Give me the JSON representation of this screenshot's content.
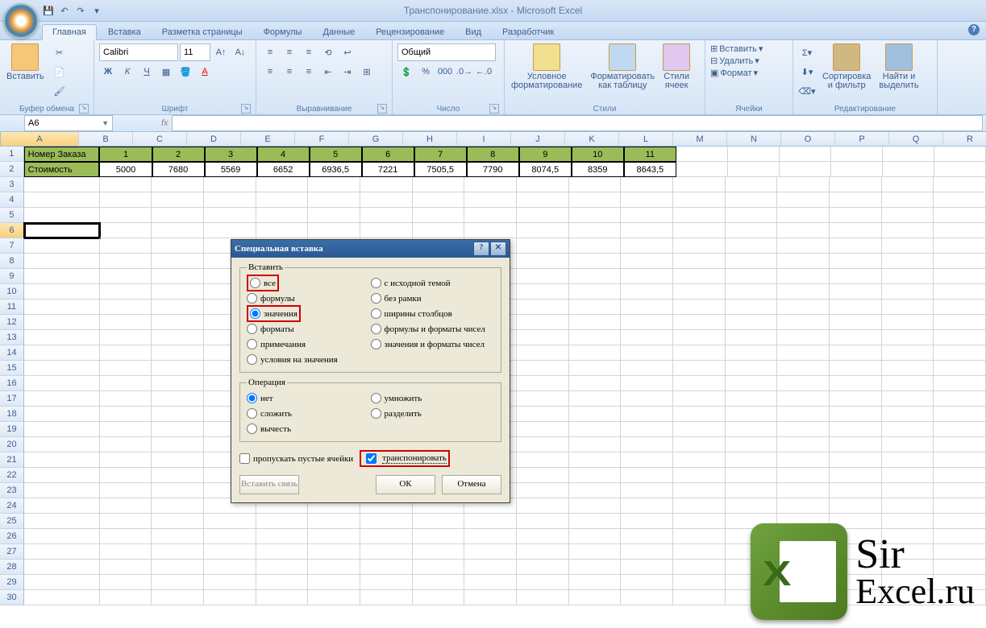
{
  "title": "Транспонирование.xlsx - Microsoft Excel",
  "qat": {
    "save": "💾",
    "undo": "↶",
    "redo": "↷"
  },
  "tabs": [
    "Главная",
    "Вставка",
    "Разметка страницы",
    "Формулы",
    "Данные",
    "Рецензирование",
    "Вид",
    "Разработчик"
  ],
  "activeTab": 0,
  "ribbon": {
    "clipboard": {
      "paste": "Вставить",
      "label": "Буфер обмена"
    },
    "font": {
      "name": "Calibri",
      "size": "11",
      "label": "Шрифт",
      "bold": "Ж",
      "italic": "К",
      "underline": "Ч"
    },
    "align": {
      "label": "Выравнивание"
    },
    "number": {
      "format": "Общий",
      "label": "Число"
    },
    "styles": {
      "cond": "Условное\nформатирование",
      "table": "Форматировать\nкак таблицу",
      "cell": "Стили\nячеек",
      "label": "Стили"
    },
    "cells": {
      "insert": "Вставить",
      "delete": "Удалить",
      "format": "Формат",
      "label": "Ячейки"
    },
    "edit": {
      "sort": "Сортировка\nи фильтр",
      "find": "Найти и\nвыделить",
      "label": "Редактирование"
    }
  },
  "namebox": "A6",
  "cols": [
    "A",
    "B",
    "C",
    "D",
    "E",
    "F",
    "G",
    "H",
    "I",
    "J",
    "K",
    "L",
    "M",
    "N",
    "O",
    "P",
    "Q",
    "R"
  ],
  "headerRow": [
    "Номер Заказа",
    "1",
    "2",
    "3",
    "4",
    "5",
    "6",
    "7",
    "8",
    "9",
    "10",
    "11"
  ],
  "dataRow": [
    "Стоимость",
    "5000",
    "7680",
    "5569",
    "6652",
    "6936,5",
    "7221",
    "7505,5",
    "7790",
    "8074,5",
    "8359",
    "8643,5"
  ],
  "rows": 30,
  "dialog": {
    "title": "Специальная вставка",
    "gPaste": "Вставить",
    "paste": {
      "all": "все",
      "formulas": "формулы",
      "values": "значения",
      "formats": "форматы",
      "comments": "примечания",
      "validation": "условия на значения",
      "theme": "с исходной темой",
      "noborder": "без рамки",
      "colwidth": "ширины столбцов",
      "fnum": "формулы и форматы чисел",
      "vnum": "значения и форматы чисел"
    },
    "gOp": "Операция",
    "op": {
      "none": "нет",
      "add": "сложить",
      "sub": "вычесть",
      "mul": "умножить",
      "div": "разделить"
    },
    "skip": "пропускать пустые ячейки",
    "transpose": "транспонировать",
    "link": "Вставить связь",
    "ok": "ОК",
    "cancel": "Отмена"
  },
  "watermark": {
    "l1": "Sir",
    "l2": "Excel.ru"
  }
}
